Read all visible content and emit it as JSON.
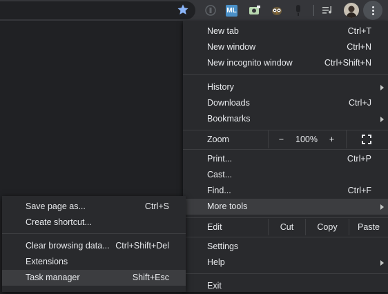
{
  "toolbar": {
    "icons": [
      "bookmark-star-icon",
      "shield-extension-icon",
      "ml-extension-icon",
      "screenshot-extension-icon",
      "owl-extension-icon",
      "mic-extension-icon",
      "media-queue-icon",
      "profile-avatar",
      "chrome-menu-dots-icon"
    ],
    "ml_label": "ML",
    "accent": "#8ab4f8"
  },
  "menu": {
    "new_tab": {
      "label": "New tab",
      "shortcut": "Ctrl+T"
    },
    "new_window": {
      "label": "New window",
      "shortcut": "Ctrl+N"
    },
    "new_incognito": {
      "label": "New incognito window",
      "shortcut": "Ctrl+Shift+N"
    },
    "history": {
      "label": "History"
    },
    "downloads": {
      "label": "Downloads",
      "shortcut": "Ctrl+J"
    },
    "bookmarks": {
      "label": "Bookmarks"
    },
    "zoom": {
      "label": "Zoom",
      "minus": "−",
      "value": "100%",
      "plus": "+"
    },
    "print": {
      "label": "Print...",
      "shortcut": "Ctrl+P"
    },
    "cast": {
      "label": "Cast..."
    },
    "find": {
      "label": "Find...",
      "shortcut": "Ctrl+F"
    },
    "more_tools": {
      "label": "More tools"
    },
    "edit": {
      "label": "Edit",
      "cut": "Cut",
      "copy": "Copy",
      "paste": "Paste"
    },
    "settings": {
      "label": "Settings"
    },
    "help": {
      "label": "Help"
    },
    "exit": {
      "label": "Exit"
    }
  },
  "submenu": {
    "save_page": {
      "label": "Save page as...",
      "shortcut": "Ctrl+S"
    },
    "create_shortcut": {
      "label": "Create shortcut..."
    },
    "clear_data": {
      "label": "Clear browsing data...",
      "shortcut": "Ctrl+Shift+Del"
    },
    "extensions": {
      "label": "Extensions"
    },
    "task_manager": {
      "label": "Task manager",
      "shortcut": "Shift+Esc"
    }
  }
}
